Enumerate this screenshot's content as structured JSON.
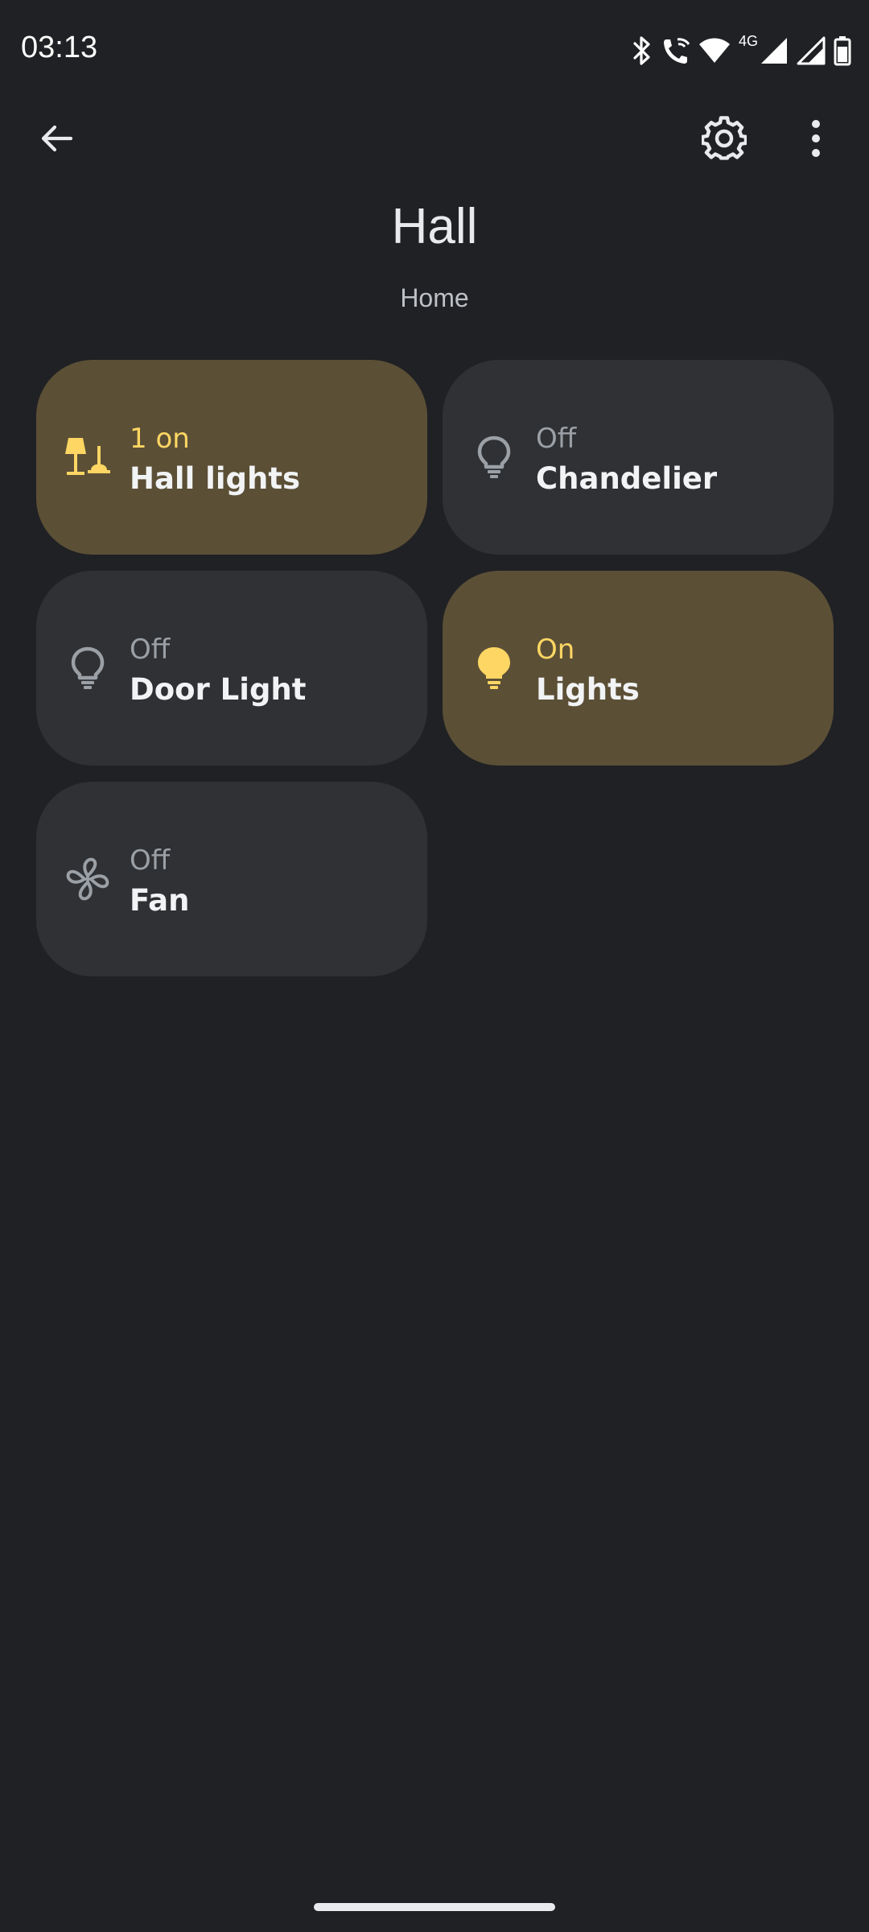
{
  "status_bar": {
    "time": "03:13",
    "network_label": "4G"
  },
  "header": {
    "title": "Hall",
    "subtitle": "Home"
  },
  "colors": {
    "background": "#202124",
    "tile_off": "#303134",
    "tile_on": "#5b4f36",
    "accent_on": "#fdd663"
  },
  "tiles": [
    {
      "status": "1 on",
      "name": "Hall lights",
      "state": "on",
      "icon": "lamp-group-icon"
    },
    {
      "status": "Off",
      "name": "Chandelier",
      "state": "off",
      "icon": "lightbulb-outline-icon"
    },
    {
      "status": "Off",
      "name": "Door Light",
      "state": "off",
      "icon": "lightbulb-outline-icon"
    },
    {
      "status": "On",
      "name": "Lights",
      "state": "on",
      "icon": "lightbulb-filled-icon"
    },
    {
      "status": "Off",
      "name": "Fan",
      "state": "off",
      "icon": "fan-icon"
    }
  ]
}
